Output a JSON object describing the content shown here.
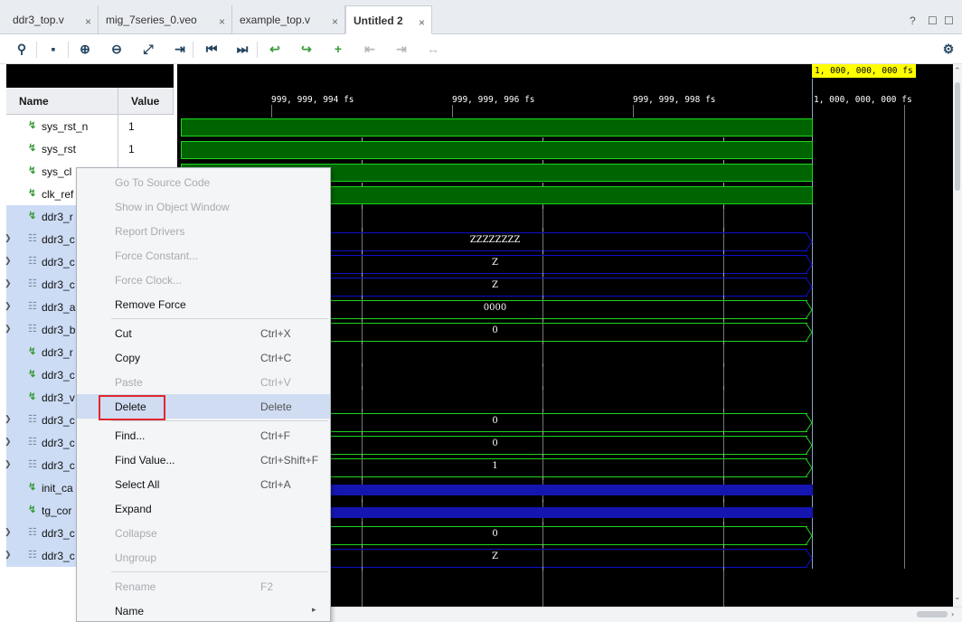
{
  "tabs": [
    {
      "label": "ddr3_top.v",
      "close": "×"
    },
    {
      "label": "mig_7series_0.veo",
      "close": "×"
    },
    {
      "label": "example_top.v",
      "close": "×"
    },
    {
      "label": "Untitled 2",
      "close": "×"
    }
  ],
  "window_controls": [
    "?",
    "☐",
    "☐"
  ],
  "columns": {
    "name": "Name",
    "value": "Value"
  },
  "signals": [
    {
      "name": "sys_rst_n",
      "value": "1",
      "kind": "bit",
      "expand": false,
      "selected": false
    },
    {
      "name": "sys_rst",
      "value": "1",
      "kind": "bit",
      "expand": false,
      "selected": false
    },
    {
      "name": "sys_cl",
      "value": "",
      "kind": "bit",
      "expand": false,
      "selected": false
    },
    {
      "name": "clk_ref",
      "value": "",
      "kind": "bit",
      "expand": false,
      "selected": false
    },
    {
      "name": "ddr3_r",
      "value": "",
      "kind": "bit",
      "expand": false,
      "selected": true
    },
    {
      "name": "ddr3_c",
      "value": "",
      "kind": "bus",
      "expand": true,
      "selected": true
    },
    {
      "name": "ddr3_c",
      "value": "",
      "kind": "bus",
      "expand": true,
      "selected": true
    },
    {
      "name": "ddr3_c",
      "value": "",
      "kind": "bus",
      "expand": true,
      "selected": true
    },
    {
      "name": "ddr3_a",
      "value": "",
      "kind": "bus",
      "expand": true,
      "selected": true
    },
    {
      "name": "ddr3_b",
      "value": "",
      "kind": "bus",
      "expand": true,
      "selected": true
    },
    {
      "name": "ddr3_r",
      "value": "",
      "kind": "bit",
      "expand": false,
      "selected": true
    },
    {
      "name": "ddr3_c",
      "value": "",
      "kind": "bit",
      "expand": false,
      "selected": true
    },
    {
      "name": "ddr3_v",
      "value": "",
      "kind": "bit",
      "expand": false,
      "selected": true
    },
    {
      "name": "ddr3_c",
      "value": "",
      "kind": "bus",
      "expand": true,
      "selected": true
    },
    {
      "name": "ddr3_c",
      "value": "",
      "kind": "bus",
      "expand": true,
      "selected": true
    },
    {
      "name": "ddr3_c",
      "value": "",
      "kind": "bus",
      "expand": true,
      "selected": true
    },
    {
      "name": "init_ca",
      "value": "",
      "kind": "bit",
      "expand": false,
      "selected": true
    },
    {
      "name": "tg_cor",
      "value": "",
      "kind": "bit",
      "expand": false,
      "selected": true
    },
    {
      "name": "ddr3_c",
      "value": "",
      "kind": "bus",
      "expand": true,
      "selected": true
    },
    {
      "name": "ddr3_c",
      "value": "",
      "kind": "bus",
      "expand": true,
      "selected": true
    }
  ],
  "timeline": {
    "cursor": "1, 000, 000, 000  fs",
    "ticks": [
      "999, 999, 994  fs",
      "999, 999, 996  fs",
      "999, 999, 998  fs",
      "1, 000, 000, 000  fs"
    ]
  },
  "waves": [
    {
      "type": "green-bar"
    },
    {
      "type": "green-bar"
    },
    {
      "type": "green-bar"
    },
    {
      "type": "green-bar"
    },
    {
      "type": "none"
    },
    {
      "type": "blue-bus",
      "text": "ZZZZZZZZ"
    },
    {
      "type": "blue-bus",
      "text": "Z"
    },
    {
      "type": "blue-bus",
      "text": "Z"
    },
    {
      "type": "green-bus",
      "text": "0000"
    },
    {
      "type": "green-bus",
      "text": "0"
    },
    {
      "type": "none"
    },
    {
      "type": "none"
    },
    {
      "type": "none"
    },
    {
      "type": "green-bus",
      "text": "0"
    },
    {
      "type": "green-bus",
      "text": "0"
    },
    {
      "type": "green-bus",
      "text": "1"
    },
    {
      "type": "blue-fill"
    },
    {
      "type": "blue-fill"
    },
    {
      "type": "green-bus",
      "text": "0"
    },
    {
      "type": "blue-bus",
      "text": "Z"
    }
  ],
  "context_menu": {
    "items": [
      {
        "label": "Go To Source Code",
        "shortcut": "",
        "disabled": true
      },
      {
        "label": "Show in Object Window",
        "shortcut": "",
        "disabled": true
      },
      {
        "label": "Report Drivers",
        "shortcut": "",
        "disabled": true
      },
      {
        "label": "Force Constant...",
        "shortcut": "",
        "disabled": true
      },
      {
        "label": "Force Clock...",
        "shortcut": "",
        "disabled": true
      },
      {
        "label": "Remove Force",
        "shortcut": "",
        "disabled": false
      },
      {
        "sep": true
      },
      {
        "label": "Cut",
        "shortcut": "Ctrl+X",
        "disabled": false
      },
      {
        "label": "Copy",
        "shortcut": "Ctrl+C",
        "disabled": false
      },
      {
        "label": "Paste",
        "shortcut": "Ctrl+V",
        "disabled": true
      },
      {
        "label": "Delete",
        "shortcut": "Delete",
        "disabled": false,
        "highlight": true
      },
      {
        "sep": true
      },
      {
        "label": "Find...",
        "shortcut": "Ctrl+F",
        "disabled": false
      },
      {
        "label": "Find Value...",
        "shortcut": "Ctrl+Shift+F",
        "disabled": false
      },
      {
        "label": "Select All",
        "shortcut": "Ctrl+A",
        "disabled": false
      },
      {
        "label": "Expand",
        "shortcut": "",
        "disabled": false
      },
      {
        "label": "Collapse",
        "shortcut": "",
        "disabled": true
      },
      {
        "label": "Ungroup",
        "shortcut": "",
        "disabled": true
      },
      {
        "sep": true
      },
      {
        "label": "Rename",
        "shortcut": "F2",
        "disabled": true
      },
      {
        "label": "Name",
        "shortcut": "",
        "disabled": false,
        "submenu": true
      }
    ]
  },
  "colors": {
    "wave_bg": "#000000",
    "signal_green": "#1ed51e",
    "bus_blue": "#0f0fcd",
    "cursor_flag": "#ffff00",
    "highlight_box": "#e0282d"
  }
}
